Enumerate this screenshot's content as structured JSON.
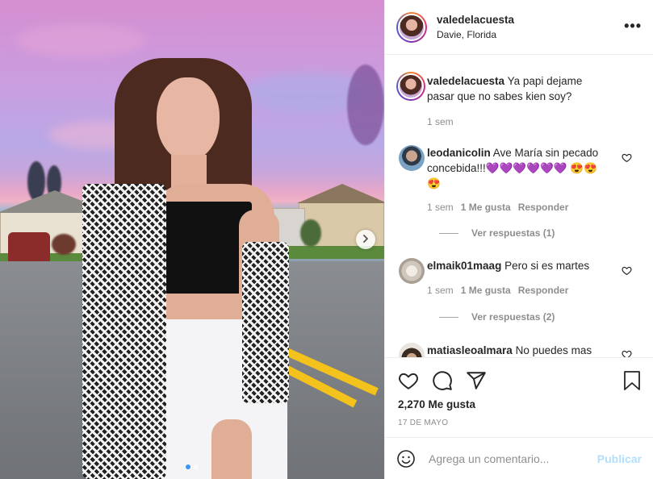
{
  "post": {
    "username": "valedelacuesta",
    "location": "Davie, Florida",
    "more_icon": "more-horizontal-icon"
  },
  "caption": {
    "username": "valedelacuesta",
    "text": "Ya papi dejame pasar que no sabes kien soy?",
    "time": "1 sem"
  },
  "comments": [
    {
      "username": "leodanicolin",
      "text": "Ave María sin pecado concebida!!!💜💜💜💜💜💜 😍😍😍",
      "time": "1 sem",
      "likes": "1 Me gusta",
      "reply": "Responder",
      "view_replies": "Ver respuestas (1)"
    },
    {
      "username": "elmaik01maag",
      "text": "Pero si es martes",
      "time": "1 sem",
      "likes": "1 Me gusta",
      "reply": "Responder",
      "view_replies": "Ver respuestas (2)"
    },
    {
      "username": "matiasleoalmara",
      "text": "No puedes mas"
    }
  ],
  "actions": {
    "like_icon": "heart-icon",
    "comment_icon": "comment-icon",
    "share_icon": "send-icon",
    "save_icon": "bookmark-icon"
  },
  "likes_count": "2,270 Me gusta",
  "date": "17 DE MAYO",
  "comment_box": {
    "placeholder": "Agrega un comentario...",
    "publish_label": "Publicar"
  },
  "colors": {
    "accent": "#3897f0",
    "publish_disabled": "#b2dffc",
    "text": "#262626",
    "muted": "#8e8e8e"
  }
}
